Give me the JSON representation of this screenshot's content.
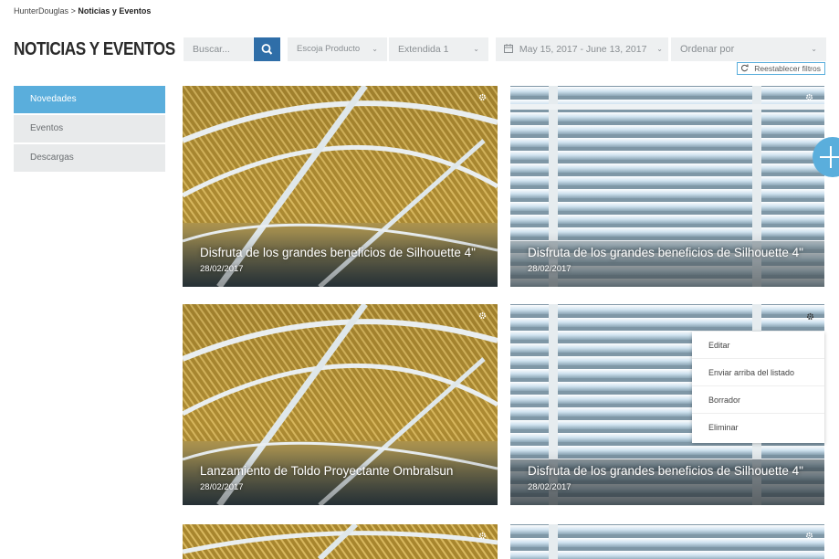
{
  "breadcrumb": {
    "root": "HunterDouglas",
    "separator": ">",
    "current": "Noticias y Eventos"
  },
  "page_title": "NOTICIAS Y EVENTOS",
  "sidebar": {
    "items": [
      {
        "label": "Novedades",
        "active": true
      },
      {
        "label": "Eventos",
        "active": false
      },
      {
        "label": "Descargas",
        "active": false
      }
    ]
  },
  "filters": {
    "search_placeholder": "Buscar...",
    "product": "Escoja Producto",
    "extension": "Extendida 1",
    "date_range": "May 15, 2017 - June 13, 2017",
    "sort": "Ordenar por",
    "reset": "Reestablecer filtros"
  },
  "cards": [
    {
      "title": "Disfruta de los grandes beneficios de Silhouette 4\"",
      "date": "28/02/2017",
      "image": "ceiling"
    },
    {
      "title": "Disfruta de los grandes beneficios de Silhouette 4\"",
      "date": "28/02/2017",
      "image": "blinds"
    },
    {
      "title": "Lanzamiento de Toldo Proyectante Ombralsun",
      "date": "28/02/2017",
      "image": "ceiling"
    },
    {
      "title": "Disfruta de los grandes beneficios de Silhouette 4\"",
      "date": "28/02/2017",
      "image": "blinds"
    }
  ],
  "context_menu": {
    "items": [
      "Editar",
      "Enviar arriba del listado",
      "Borrador",
      "Eliminar"
    ]
  },
  "colors": {
    "accent": "#5aaedc",
    "search_button": "#2f6ea8",
    "filter_bg": "#eef0f1",
    "sidebar_bg": "#e8eaeb"
  }
}
